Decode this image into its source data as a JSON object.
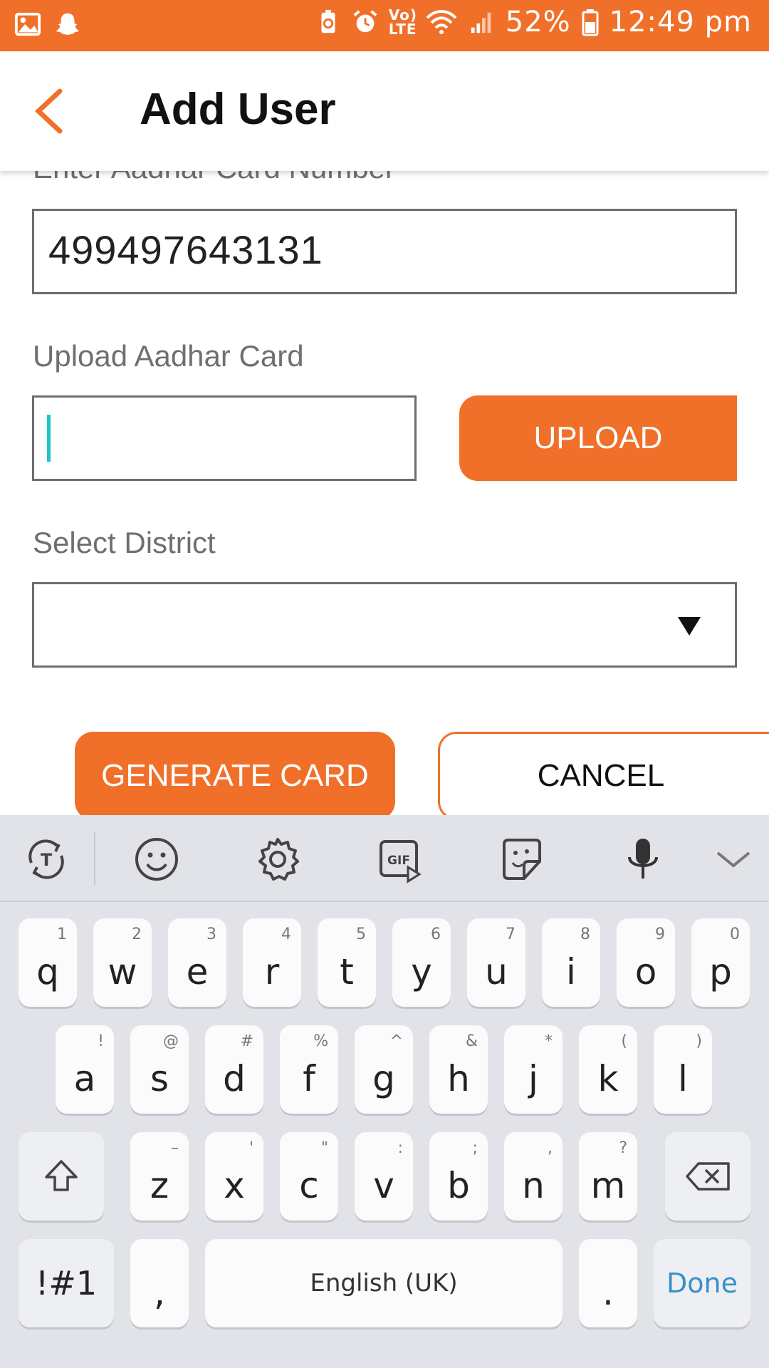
{
  "status_bar": {
    "battery": "52%",
    "time": "12:49 pm",
    "icons": [
      "gallery-icon",
      "snapchat-icon",
      "battery-saver-icon",
      "alarm-icon",
      "volte-icon",
      "wifi-icon",
      "signal-icon",
      "battery-icon"
    ],
    "volte_label": "Vo) LTE"
  },
  "app_bar": {
    "title": "Add User",
    "back_icon": "chevron-left-icon"
  },
  "form": {
    "aadhar_label": "Enter Aadhar Card Number",
    "aadhar_value": "499497643131",
    "upload_label": "Upload Aadhar Card",
    "upload_value": "",
    "upload_button": "UPLOAD",
    "district_label": "Select District",
    "district_value": "",
    "generate_button": "GENERATE CARD",
    "cancel_button": "CANCEL"
  },
  "keyboard": {
    "toolbar": [
      "translate-icon",
      "emoji-icon",
      "settings-icon",
      "gif-icon",
      "sticker-icon",
      "mic-icon",
      "collapse-icon"
    ],
    "row1": [
      {
        "k": "q",
        "h": "1"
      },
      {
        "k": "w",
        "h": "2"
      },
      {
        "k": "e",
        "h": "3"
      },
      {
        "k": "r",
        "h": "4"
      },
      {
        "k": "t",
        "h": "5"
      },
      {
        "k": "y",
        "h": "6"
      },
      {
        "k": "u",
        "h": "7"
      },
      {
        "k": "i",
        "h": "8"
      },
      {
        "k": "o",
        "h": "9"
      },
      {
        "k": "p",
        "h": "0"
      }
    ],
    "row2": [
      {
        "k": "a",
        "h": "!"
      },
      {
        "k": "s",
        "h": "@"
      },
      {
        "k": "d",
        "h": "#"
      },
      {
        "k": "f",
        "h": "%"
      },
      {
        "k": "g",
        "h": "^"
      },
      {
        "k": "h",
        "h": "&"
      },
      {
        "k": "j",
        "h": "*"
      },
      {
        "k": "k",
        "h": "("
      },
      {
        "k": "l",
        "h": ")"
      }
    ],
    "row3": [
      {
        "k": "z",
        "h": "–"
      },
      {
        "k": "x",
        "h": "'"
      },
      {
        "k": "c",
        "h": "\""
      },
      {
        "k": "v",
        "h": ":"
      },
      {
        "k": "b",
        "h": ";"
      },
      {
        "k": "n",
        "h": ","
      },
      {
        "k": "m",
        "h": "?"
      }
    ],
    "symbols": "!#1",
    "comma": ",",
    "space": "English (UK)",
    "period": ".",
    "done": "Done",
    "accent": "#f0702a",
    "done_color": "#3a8fc9"
  }
}
